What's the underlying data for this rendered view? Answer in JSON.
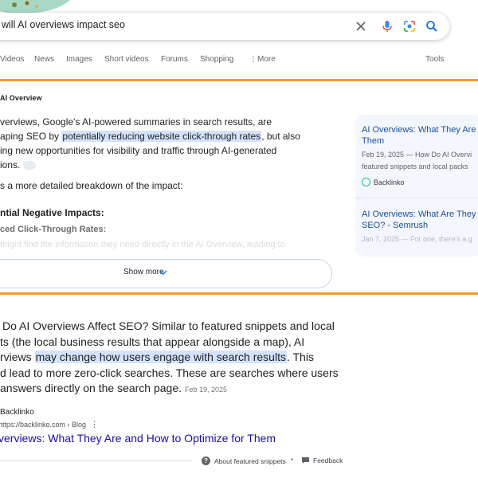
{
  "search": {
    "query": "will AI overviews impact seo"
  },
  "tabs": [
    "Videos",
    "News",
    "Images",
    "Short videos",
    "Forums",
    "Shopping",
    "More",
    "Tools"
  ],
  "ai_overview": {
    "label": "AI Overview",
    "para1_a": "verviews, Google's AI-powered summaries in search results, are",
    "para1_b_pre": "aping SEO by ",
    "para1_b_hl": "potentially reducing website click-through rates",
    "para1_b_post": ", but also",
    "para1_c": "ing new opportunities for visibility and traffic through AI-generated",
    "para1_d": "ions.",
    "breakdown": "s a more detailed breakdown of the impact:",
    "neg_heading": "ntial Negative Impacts:",
    "sub_heading": "ced Click-Through Rates:",
    "faded_line": "might find the information they need directly in the AI Overview, leading to",
    "show_more": "Show more"
  },
  "sources": [
    {
      "title": "AI Overviews: What They Are",
      "title2": "Them",
      "meta1": "Feb 19, 2025 — How Do AI Overvi",
      "meta2": "featured snippets and local packs",
      "site": "Backlinko"
    },
    {
      "title": "AI Overviews: What Are They",
      "title2": "SEO? - Semrush",
      "meta1": "Jan 7, 2025 — For one, there's a g"
    }
  ],
  "snippet": {
    "line1": "Do AI Overviews Affect SEO? Similar to featured snippets and local",
    "line2": "ts (the local business results that appear alongside a map), AI",
    "line3_pre": "rviews ",
    "line3_hl": "may change how users engage with search results",
    "line3_post": ". This",
    "line4": "d lead to more zero-click searches. These are searches where users",
    "line5": "answers directly on the search page.",
    "date": "Feb 19, 2025"
  },
  "result": {
    "site": "Backlinko",
    "url": "https://backlinko.com › Blog",
    "title": "verviews: What They Are and How to Optimize for Them"
  },
  "footer": {
    "about": "About featured snippets",
    "separator": "•",
    "feedback": "Feedback"
  },
  "colors": {
    "accent_orange": "#f59a23",
    "highlight": "#d3e3fd",
    "link_blue": "#1a0dab"
  }
}
